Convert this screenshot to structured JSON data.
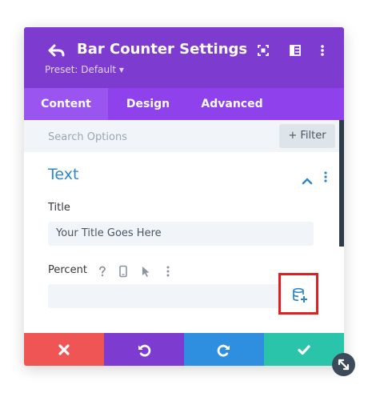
{
  "header": {
    "title": "Bar Counter Settings",
    "preset_label": "Preset: Default ▾",
    "icons": [
      "back-arrow-icon",
      "expand-icon",
      "split-view-icon",
      "more-vertical-icon"
    ],
    "color": "#7e3bd0"
  },
  "tabs": [
    {
      "label": "Content",
      "active": true
    },
    {
      "label": "Design",
      "active": false
    },
    {
      "label": "Advanced",
      "active": false
    }
  ],
  "search": {
    "placeholder": "Search Options",
    "filter_label": "+ Filter"
  },
  "section": {
    "title": "Text",
    "fields": {
      "title_label": "Title",
      "title_value": "Your Title Goes Here",
      "percent_label": "Percent",
      "percent_value": ""
    },
    "accent_color": "#2f87c8"
  },
  "footer": {
    "buttons": [
      "close-icon",
      "undo-icon",
      "redo-icon",
      "check-icon"
    ],
    "colors": [
      "#ef5555",
      "#7e3bd0",
      "#2e8ee0",
      "#29c4a9"
    ]
  }
}
